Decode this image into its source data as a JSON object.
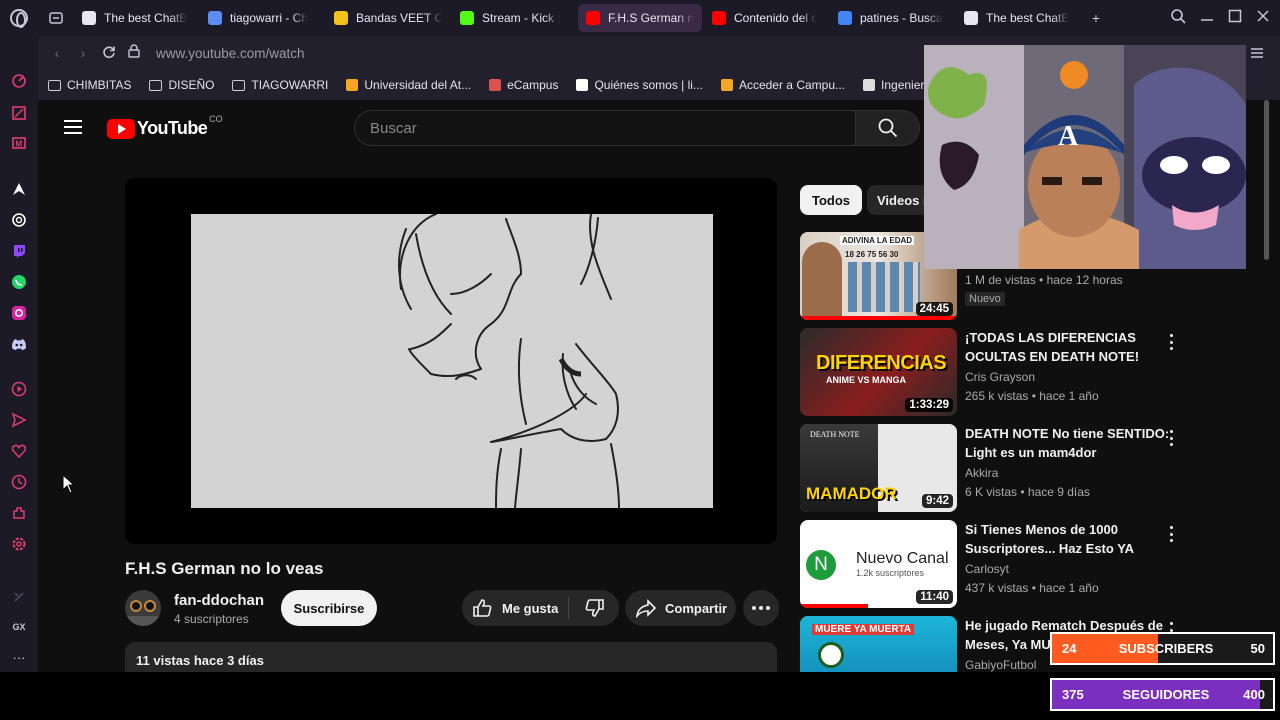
{
  "browser": {
    "tabs": [
      {
        "title": "The best ChatB",
        "favicon_color": "#e8e6f0",
        "active": false
      },
      {
        "title": "tiagowarri - Ch",
        "favicon_color": "#5b8df5",
        "active": false
      },
      {
        "title": "Bandas VEET C",
        "favicon_color": "#f2c318",
        "active": false
      },
      {
        "title": "Stream - Kick |",
        "favicon_color": "#53fc18",
        "active": false
      },
      {
        "title": "F.H.S German no lo ve",
        "favicon_color": "#ff0000",
        "active": true
      },
      {
        "title": "Contenido del c",
        "favicon_color": "#ff0000",
        "active": false
      },
      {
        "title": "patines - Busca",
        "favicon_color": "#4285f4",
        "active": false
      },
      {
        "title": "The best ChatB",
        "favicon_color": "#e8e6f0",
        "active": false
      }
    ],
    "new_tab_label": "+",
    "url": "www.youtube.com/watch",
    "bookmarks": [
      {
        "label": "CHIMBITAS",
        "type": "folder"
      },
      {
        "label": "DISEÑO",
        "type": "folder"
      },
      {
        "label": "TIAGOWARRI",
        "type": "folder"
      },
      {
        "label": "Universidad del At...",
        "type": "site",
        "color": "#f5a623"
      },
      {
        "label": "eCampus",
        "type": "site",
        "color": "#d9534f"
      },
      {
        "label": "Quiénes somos | li...",
        "type": "site",
        "color": "#ffffff"
      },
      {
        "label": "Acceder a Campu...",
        "type": "site",
        "color": "#f5a623"
      },
      {
        "label": "Ingeniería",
        "type": "site",
        "color": "#dddddd"
      }
    ],
    "sidebar_icons": [
      "speed-dial-icon",
      "news-icon",
      "mail-icon",
      "aria-icon",
      "chatgpt-icon",
      "twitch-icon",
      "whatsapp-icon",
      "instagram-icon",
      "discord-icon",
      "player-icon",
      "send-icon",
      "heart-icon",
      "history-icon",
      "extensions-icon",
      "settings-icon",
      "unknown-icon",
      "gx-icon",
      "more-icon"
    ]
  },
  "youtube": {
    "logo_text": "YouTube",
    "country_code": "CO",
    "search_placeholder": "Buscar",
    "video": {
      "title": "F.H.S German no lo veas",
      "channel_name": "fan-ddochan",
      "channel_subs": "4 suscriptores",
      "subscribe_label": "Suscribirse",
      "like_label": "Me gusta",
      "share_label": "Compartir",
      "description_summary": "11 vistas  hace 3 días"
    },
    "chips": [
      "Todos",
      "Videos r"
    ],
    "recommendations": [
      {
        "title": "",
        "meta1": "1 M de vistas • hace 12 horas",
        "meta2": "Nuevo",
        "duration": "24:45",
        "thumb_text": "ADIVINA LA EDAD",
        "thumb_numbers": "18 26 75 56 30",
        "progress": 1.0
      },
      {
        "title": "¡TODAS LAS DIFERENCIAS OCULTAS EN DEATH NOTE!",
        "meta1": "Cris Grayson",
        "meta2": "265 k vistas • hace 1 año",
        "duration": "1:33:29",
        "thumb_text": "DIFERENCIAS",
        "thumb_sub": "ANIME VS MANGA",
        "progress": 0
      },
      {
        "title": "DEATH NOTE No tiene SENTIDO: Light es un mam4dor",
        "meta1": "Akkira",
        "meta2": "6 K vistas • hace 9 días",
        "duration": "9:42",
        "thumb_text": "MAMADOR",
        "thumb_sub": "DEATH NOTE",
        "progress": 0
      },
      {
        "title": "Si Tienes Menos de 1000 Suscriptores... Haz Esto YA",
        "meta1": "Carlosyt",
        "meta2": "437 k vistas • hace 1 año",
        "duration": "11:40",
        "thumb_text": "Nuevo Canal",
        "thumb_sub": "1.2k suscriptores",
        "thumb_letter": "N",
        "progress": 0.43
      },
      {
        "title": "He jugado Rematch Después de Meses, Ya MUERE",
        "meta1": "GabiyoFutbol",
        "meta2": "",
        "duration": "",
        "thumb_text": "MUERE YA MUERTA",
        "progress": 0
      }
    ]
  },
  "overlays": {
    "subscribers_goal": {
      "current": "24",
      "label": "SUBSCRIBERS",
      "target": "50",
      "fill": 0.48,
      "color": "#ff5a1f"
    },
    "followers_goal": {
      "current": "375",
      "label": "SEGUIDORES",
      "target": "400",
      "fill": 0.94,
      "color": "#7b2fbf"
    }
  }
}
